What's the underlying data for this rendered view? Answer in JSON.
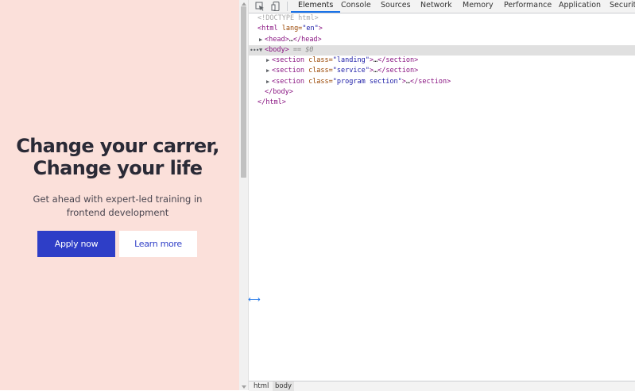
{
  "page": {
    "title_line1": "Change your carrer,",
    "title_line2": "Change your life",
    "subtitle_line1": "Get ahead with expert-led training in",
    "subtitle_line2": "frontend development",
    "apply_label": "Apply now",
    "learn_label": "Learn more",
    "bg_color": "#fbe0da",
    "accent_color": "#2e3ec7"
  },
  "devtools": {
    "toolbar": {
      "inspect_icon": "inspect-element-icon",
      "device_icon": "device-toolbar-icon"
    },
    "tabs": [
      "Elements",
      "Console",
      "Sources",
      "Network",
      "Memory",
      "Performance",
      "Application",
      "Security"
    ],
    "active_tab": "Elements",
    "tree": {
      "doctype": "<!DOCTYPE html>",
      "html_open_tag": "<html",
      "html_attr": " lang=",
      "html_attr_val": "\"en\"",
      "html_open_close": ">",
      "head": "<head>",
      "head_ellipsis": "…",
      "head_close": "</head>",
      "body": "<body>",
      "body_ref": " == $0",
      "sections": [
        {
          "open": "<section",
          "attr": " class=",
          "val": "\"landing\"",
          "gt": ">",
          "ellipsis": "…",
          "close": "</section>"
        },
        {
          "open": "<section",
          "attr": " class=",
          "val": "\"service\"",
          "gt": ">",
          "ellipsis": "…",
          "close": "</section>"
        },
        {
          "open": "<section",
          "attr": " class=",
          "val": "\"program section\"",
          "gt": ">",
          "ellipsis": "…",
          "close": "</section>"
        }
      ],
      "body_close": "</body>",
      "html_close": "</html>"
    },
    "breadcrumbs": [
      "html",
      "body"
    ]
  }
}
